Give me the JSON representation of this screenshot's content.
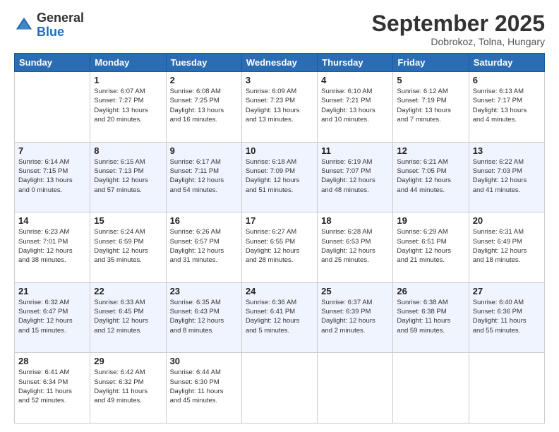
{
  "logo": {
    "general": "General",
    "blue": "Blue"
  },
  "header": {
    "month": "September 2025",
    "location": "Dobrokoz, Tolna, Hungary"
  },
  "weekdays": [
    "Sunday",
    "Monday",
    "Tuesday",
    "Wednesday",
    "Thursday",
    "Friday",
    "Saturday"
  ],
  "weeks": [
    [
      {
        "day": "",
        "info": ""
      },
      {
        "day": "1",
        "info": "Sunrise: 6:07 AM\nSunset: 7:27 PM\nDaylight: 13 hours\nand 20 minutes."
      },
      {
        "day": "2",
        "info": "Sunrise: 6:08 AM\nSunset: 7:25 PM\nDaylight: 13 hours\nand 16 minutes."
      },
      {
        "day": "3",
        "info": "Sunrise: 6:09 AM\nSunset: 7:23 PM\nDaylight: 13 hours\nand 13 minutes."
      },
      {
        "day": "4",
        "info": "Sunrise: 6:10 AM\nSunset: 7:21 PM\nDaylight: 13 hours\nand 10 minutes."
      },
      {
        "day": "5",
        "info": "Sunrise: 6:12 AM\nSunset: 7:19 PM\nDaylight: 13 hours\nand 7 minutes."
      },
      {
        "day": "6",
        "info": "Sunrise: 6:13 AM\nSunset: 7:17 PM\nDaylight: 13 hours\nand 4 minutes."
      }
    ],
    [
      {
        "day": "7",
        "info": "Sunrise: 6:14 AM\nSunset: 7:15 PM\nDaylight: 13 hours\nand 0 minutes."
      },
      {
        "day": "8",
        "info": "Sunrise: 6:15 AM\nSunset: 7:13 PM\nDaylight: 12 hours\nand 57 minutes."
      },
      {
        "day": "9",
        "info": "Sunrise: 6:17 AM\nSunset: 7:11 PM\nDaylight: 12 hours\nand 54 minutes."
      },
      {
        "day": "10",
        "info": "Sunrise: 6:18 AM\nSunset: 7:09 PM\nDaylight: 12 hours\nand 51 minutes."
      },
      {
        "day": "11",
        "info": "Sunrise: 6:19 AM\nSunset: 7:07 PM\nDaylight: 12 hours\nand 48 minutes."
      },
      {
        "day": "12",
        "info": "Sunrise: 6:21 AM\nSunset: 7:05 PM\nDaylight: 12 hours\nand 44 minutes."
      },
      {
        "day": "13",
        "info": "Sunrise: 6:22 AM\nSunset: 7:03 PM\nDaylight: 12 hours\nand 41 minutes."
      }
    ],
    [
      {
        "day": "14",
        "info": "Sunrise: 6:23 AM\nSunset: 7:01 PM\nDaylight: 12 hours\nand 38 minutes."
      },
      {
        "day": "15",
        "info": "Sunrise: 6:24 AM\nSunset: 6:59 PM\nDaylight: 12 hours\nand 35 minutes."
      },
      {
        "day": "16",
        "info": "Sunrise: 6:26 AM\nSunset: 6:57 PM\nDaylight: 12 hours\nand 31 minutes."
      },
      {
        "day": "17",
        "info": "Sunrise: 6:27 AM\nSunset: 6:55 PM\nDaylight: 12 hours\nand 28 minutes."
      },
      {
        "day": "18",
        "info": "Sunrise: 6:28 AM\nSunset: 6:53 PM\nDaylight: 12 hours\nand 25 minutes."
      },
      {
        "day": "19",
        "info": "Sunrise: 6:29 AM\nSunset: 6:51 PM\nDaylight: 12 hours\nand 21 minutes."
      },
      {
        "day": "20",
        "info": "Sunrise: 6:31 AM\nSunset: 6:49 PM\nDaylight: 12 hours\nand 18 minutes."
      }
    ],
    [
      {
        "day": "21",
        "info": "Sunrise: 6:32 AM\nSunset: 6:47 PM\nDaylight: 12 hours\nand 15 minutes."
      },
      {
        "day": "22",
        "info": "Sunrise: 6:33 AM\nSunset: 6:45 PM\nDaylight: 12 hours\nand 12 minutes."
      },
      {
        "day": "23",
        "info": "Sunrise: 6:35 AM\nSunset: 6:43 PM\nDaylight: 12 hours\nand 8 minutes."
      },
      {
        "day": "24",
        "info": "Sunrise: 6:36 AM\nSunset: 6:41 PM\nDaylight: 12 hours\nand 5 minutes."
      },
      {
        "day": "25",
        "info": "Sunrise: 6:37 AM\nSunset: 6:39 PM\nDaylight: 12 hours\nand 2 minutes."
      },
      {
        "day": "26",
        "info": "Sunrise: 6:38 AM\nSunset: 6:38 PM\nDaylight: 11 hours\nand 59 minutes."
      },
      {
        "day": "27",
        "info": "Sunrise: 6:40 AM\nSunset: 6:36 PM\nDaylight: 11 hours\nand 55 minutes."
      }
    ],
    [
      {
        "day": "28",
        "info": "Sunrise: 6:41 AM\nSunset: 6:34 PM\nDaylight: 11 hours\nand 52 minutes."
      },
      {
        "day": "29",
        "info": "Sunrise: 6:42 AM\nSunset: 6:32 PM\nDaylight: 11 hours\nand 49 minutes."
      },
      {
        "day": "30",
        "info": "Sunrise: 6:44 AM\nSunset: 6:30 PM\nDaylight: 11 hours\nand 45 minutes."
      },
      {
        "day": "",
        "info": ""
      },
      {
        "day": "",
        "info": ""
      },
      {
        "day": "",
        "info": ""
      },
      {
        "day": "",
        "info": ""
      }
    ]
  ]
}
